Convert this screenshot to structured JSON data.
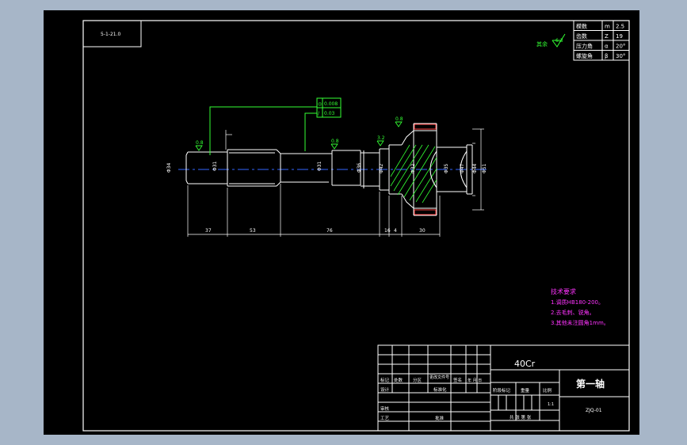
{
  "material": "40Cr",
  "part_name": "第一轴",
  "top_left_code": "5-1-21.0",
  "drawing_no": "ZJQ-01",
  "scale": "1:1",
  "roughness_rest_label": "其余",
  "roughness_rest_value": "6.3",
  "gear_params": [
    {
      "name": "模数",
      "symbol": "m",
      "value": "2.5"
    },
    {
      "name": "齿数",
      "symbol": "Z",
      "value": "19"
    },
    {
      "name": "压力角",
      "symbol": "α",
      "value": "20°"
    },
    {
      "name": "螺旋角",
      "symbol": "β",
      "value": "30°"
    }
  ],
  "tolerance_frame": [
    {
      "symbol": "◎",
      "value": "0.008"
    },
    {
      "symbol": "/",
      "value": "0.03"
    }
  ],
  "roughness_marks": [
    "0.8",
    "0.8",
    "3.2",
    "0.8"
  ],
  "diameters": [
    "Φ34",
    "Φ31",
    "Φ31",
    "Φ36",
    "Φ42",
    "Φ32",
    "Φ35",
    "Φ47",
    "Φ44",
    "Φ51"
  ],
  "lengths": [
    "37",
    "53",
    "76",
    "16",
    "4",
    "30"
  ],
  "tech_requirements": {
    "title": "技术要求",
    "items": [
      "1.调质HB180-200。",
      "2.去毛刺、锐角。",
      "3.其他未注圆角1mm。"
    ]
  },
  "title_block": {
    "mark": "标记",
    "count": "处数",
    "zone": "分区",
    "change_doc": "更改文件号",
    "signature": "签名",
    "date": "年 月 日",
    "design": "设计",
    "standardize": "标准化",
    "stage_mark": "阶段标记",
    "weight": "重量",
    "scale_label": "比例",
    "review": "审核",
    "process": "工艺",
    "approve": "批准",
    "sheet": "共 张 第 张"
  }
}
